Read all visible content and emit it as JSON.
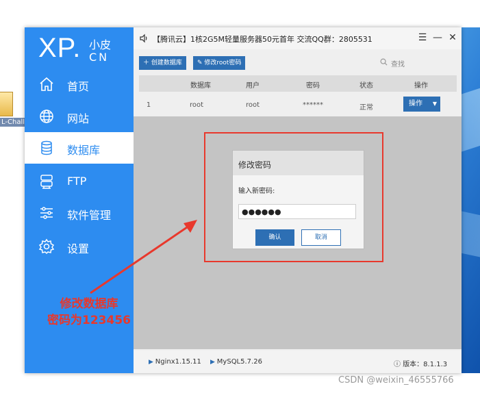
{
  "desktop": {
    "icon_label": "L-Challe"
  },
  "app": {
    "logo": {
      "brand": "XP.",
      "small": "小皮",
      "cn": "CN"
    },
    "nav": [
      {
        "label": "首页",
        "icon": "home-icon"
      },
      {
        "label": "网站",
        "icon": "globe-icon"
      },
      {
        "label": "数据库",
        "icon": "database-icon",
        "active": true
      },
      {
        "label": "FTP",
        "icon": "server-icon"
      },
      {
        "label": "软件管理",
        "icon": "sliders-icon"
      },
      {
        "label": "设置",
        "icon": "gear-icon"
      }
    ],
    "title": "【腾讯云】1核2G5M轻量服务器50元首年 交流QQ群：2805531",
    "toolbar": {
      "create_db": "创建数据库",
      "change_root_pwd": "修改root密码",
      "search_placeholder": "查找"
    },
    "table": {
      "headers": [
        "数据库",
        "用户",
        "密码",
        "状态",
        "操作"
      ],
      "row": {
        "index": "1",
        "database": "root",
        "user": "root",
        "password": "******",
        "status": "正常",
        "action": "操作"
      }
    },
    "status": {
      "nginx": "Nginx1.15.11",
      "mysql": "MySQL5.7.26",
      "version": "版本：8.1.1.3"
    }
  },
  "dialog": {
    "title": "修改密码",
    "label": "输入新密码:",
    "value": "●●●●●●",
    "ok": "确认",
    "cancel": "取消"
  },
  "annotation": {
    "line1": "修改数据库",
    "line2": "密码为123456"
  },
  "watermark": "CSDN @weixin_46555766",
  "colors": {
    "accent": "#2d8cf0",
    "button": "#2d6fb4",
    "annotation": "#e8382c"
  }
}
